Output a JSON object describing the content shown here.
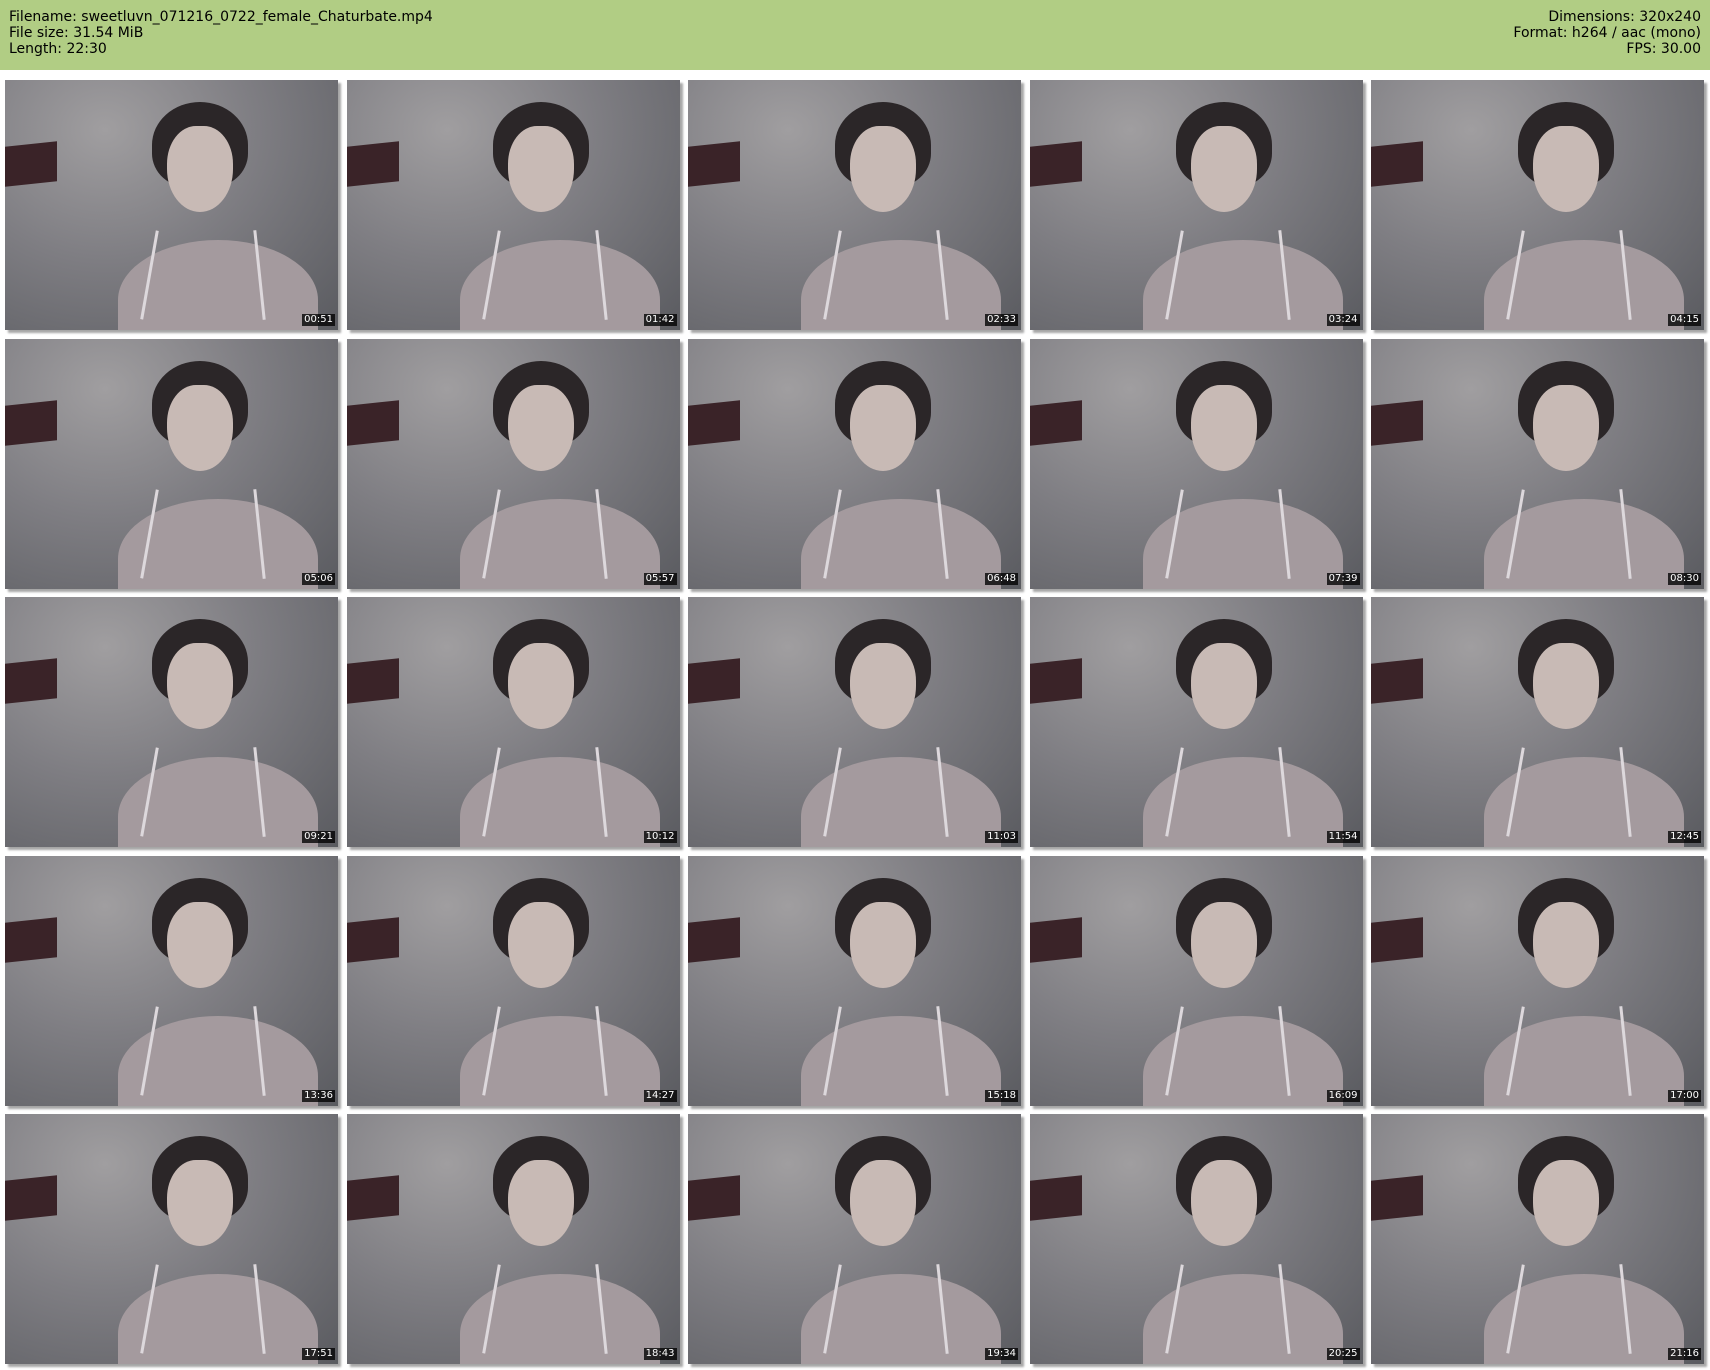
{
  "header": {
    "filename": "Filename: sweetluvn_071216_0722_female_Chaturbate.mp4",
    "file_size": "File size: 31.54 MiB",
    "length": "Length: 22:30",
    "dimensions": "Dimensions: 320x240",
    "format": "Format: h264 / aac (mono)",
    "fps": "FPS: 30.00"
  },
  "thumbnails": [
    {
      "timestamp": "00:51"
    },
    {
      "timestamp": "01:42"
    },
    {
      "timestamp": "02:33"
    },
    {
      "timestamp": "03:24"
    },
    {
      "timestamp": "04:15"
    },
    {
      "timestamp": "05:06"
    },
    {
      "timestamp": "05:57"
    },
    {
      "timestamp": "06:48"
    },
    {
      "timestamp": "07:39"
    },
    {
      "timestamp": "08:30"
    },
    {
      "timestamp": "09:21"
    },
    {
      "timestamp": "10:12"
    },
    {
      "timestamp": "11:03"
    },
    {
      "timestamp": "11:54"
    },
    {
      "timestamp": "12:45"
    },
    {
      "timestamp": "13:36"
    },
    {
      "timestamp": "14:27"
    },
    {
      "timestamp": "15:18"
    },
    {
      "timestamp": "16:09"
    },
    {
      "timestamp": "17:00"
    },
    {
      "timestamp": "17:51"
    },
    {
      "timestamp": "18:43"
    },
    {
      "timestamp": "19:34"
    },
    {
      "timestamp": "20:25"
    },
    {
      "timestamp": "21:16"
    }
  ],
  "colors": {
    "header_bg": "#b1cd84",
    "timestamp_bg": "#000000",
    "timestamp_fg": "#ffffff"
  }
}
